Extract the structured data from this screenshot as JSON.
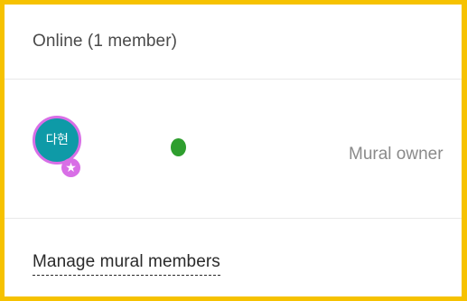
{
  "header": {
    "title": "Online (1 member)"
  },
  "members": [
    {
      "initials": "다현",
      "role": "Mural owner",
      "status": "online",
      "status_color": "#2e9e2e",
      "avatar_color": "#0e9aa7",
      "avatar_ring_color": "#d86ee6",
      "badge_icon": "star-icon"
    }
  ],
  "footer": {
    "manage_label": "Manage mural members"
  },
  "colors": {
    "frame": "#f6c200"
  }
}
